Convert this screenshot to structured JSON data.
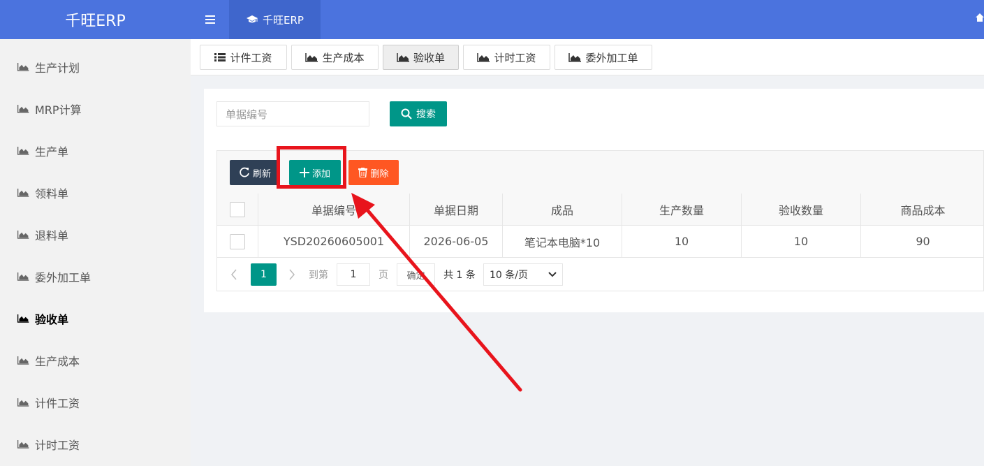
{
  "header": {
    "brand": "千旺ERP",
    "app_tab": "千旺ERP",
    "icons": [
      "menu-icon",
      "graduation-cap-icon",
      "home-icon"
    ],
    "color": "#4b73de"
  },
  "sidebar": {
    "items": [
      {
        "label": "生产计划"
      },
      {
        "label": "MRP计算"
      },
      {
        "label": "生产单"
      },
      {
        "label": "领料单"
      },
      {
        "label": "退料单"
      },
      {
        "label": "委外加工单"
      },
      {
        "label": "验收单",
        "active": true
      },
      {
        "label": "生产成本"
      },
      {
        "label": "计件工资"
      },
      {
        "label": "计时工资"
      }
    ]
  },
  "tabs": [
    {
      "label": "计件工资",
      "icon": "list-icon"
    },
    {
      "label": "生产成本",
      "icon": "area-chart-icon"
    },
    {
      "label": "验收单",
      "icon": "area-chart-icon",
      "active": true
    },
    {
      "label": "计时工资",
      "icon": "area-chart-icon"
    },
    {
      "label": "委外加工单",
      "icon": "area-chart-icon"
    }
  ],
  "search": {
    "placeholder": "单据编号",
    "button": "搜索",
    "color": "#009688"
  },
  "toolbar": {
    "refresh": "刷新",
    "add": "添加",
    "delete": "删除",
    "colors": {
      "refresh": "#2f4056",
      "add": "#009688",
      "delete": "#ff5722"
    }
  },
  "table": {
    "columns": [
      "单据编号",
      "单据日期",
      "成品",
      "生产数量",
      "验收数量",
      "商品成本"
    ],
    "rows": [
      [
        "YSD20260605001",
        "2026-06-05",
        "笔记本电脑*10",
        "10",
        "10",
        "90"
      ]
    ]
  },
  "pagination": {
    "current": "1",
    "goto_label": "到第",
    "page_input": "1",
    "page_unit": "页",
    "confirm": "确定",
    "total": "共 1 条",
    "page_size": "10 条/页"
  },
  "annotation": {
    "highlight_color": "#e8141c"
  }
}
